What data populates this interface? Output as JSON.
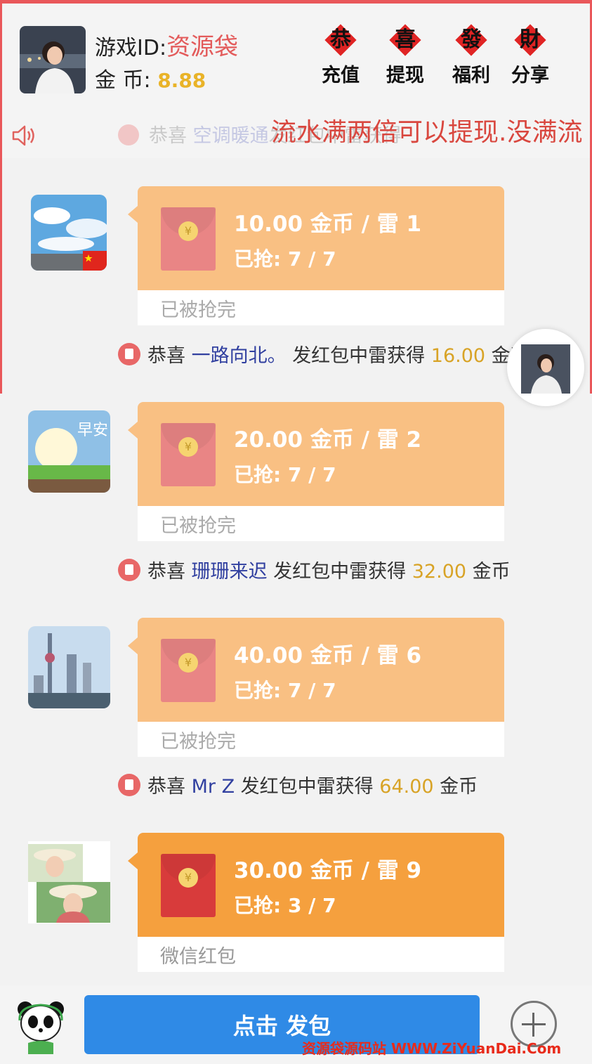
{
  "header": {
    "game_id_label": "游戏ID:",
    "game_id_value": "资源袋",
    "coin_label": "金  币:",
    "coin_value": "8.88",
    "buttons": [
      {
        "seal": "恭",
        "label": "充值"
      },
      {
        "seal": "喜",
        "label": "提现"
      },
      {
        "seal": "發",
        "label": "福利"
      },
      {
        "seal": "財",
        "label": "分享"
      }
    ]
  },
  "marquee": {
    "prefix": "恭喜",
    "name": "空调暖通",
    "rest": "发红包中雷获得",
    "overlay_text": "流水满两倍可以提现.没满流"
  },
  "messages": [
    {
      "amount": "10.00 金币 / 雷 1",
      "grabbed": "已抢: 7 / 7",
      "status": "已被抢完",
      "active": false
    },
    {
      "amount": "20.00 金币 / 雷 2",
      "grabbed": "已抢: 7 / 7",
      "status": "已被抢完",
      "active": false
    },
    {
      "amount": "40.00 金币 / 雷 6",
      "grabbed": "已抢: 7 / 7",
      "status": "已被抢完",
      "active": false
    },
    {
      "amount": "30.00 金币 / 雷 9",
      "grabbed": "已抢: 3 / 7",
      "status": "微信红包",
      "active": true
    }
  ],
  "notices": [
    {
      "prefix": "恭喜",
      "name": "一路向北。",
      "middle": "发红包中雷获得",
      "value": "16.00",
      "unit": "金币"
    },
    {
      "prefix": "恭喜",
      "name": "珊珊来迟",
      "middle": "发红包中雷获得",
      "value": "32.00",
      "unit": "金币"
    },
    {
      "prefix": "恭喜",
      "name": "Mr Z",
      "middle": "发红包中雷获得",
      "value": "64.00",
      "unit": "金币"
    }
  ],
  "avatar_overlays": {
    "morning_text": "早安"
  },
  "bottom": {
    "send_label": "点击 发包",
    "watermark": "资源袋源码站  WWW.ZiYuanDai.Com"
  },
  "colors": {
    "accent_blue": "#2f8ae6",
    "bubble_orange": "#f9c083",
    "bubble_active": "#f5a03e",
    "frame_red": "#e9575a"
  }
}
